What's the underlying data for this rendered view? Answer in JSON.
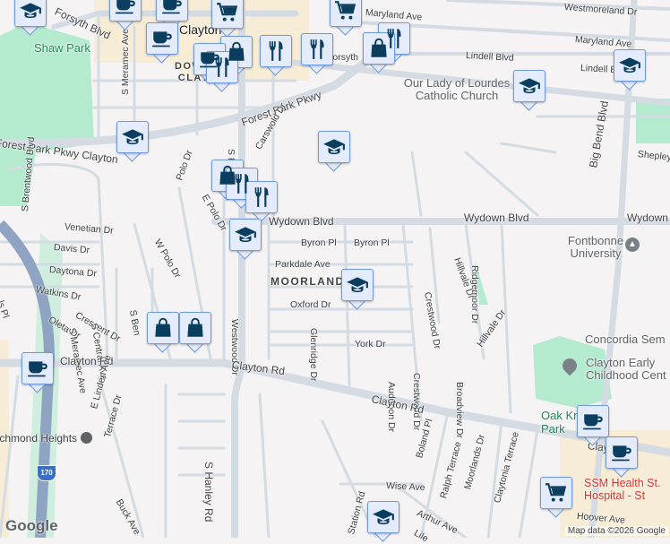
{
  "colors": {
    "background": "#f5f3f3",
    "road": "#d4dbe3",
    "park": "#b4ebcf",
    "downtown": "#f7ecd6",
    "highway": "#8fa4c2",
    "marker_fill": "#e4ecfb",
    "marker_border": "#6f9ae0",
    "icon": "#0b3d5e"
  },
  "streets": {
    "forsyth_top": "Forsyth Blvd",
    "forsyth": "Forsyth",
    "maryland": "Maryland Ave",
    "maryland_east": "Maryland Ave",
    "westmoreland": "Westmoreland Dr",
    "lindell": "Lindell Blvd",
    "lindell_east": "Lindell Blvd",
    "forest_park": "Forest Park Pkwy",
    "forest_park_clayton": "Forest Park Pkwy Clayton",
    "s_meramec": "S Meramec Ave",
    "carswold": "Carswold Dr",
    "polo": "Polo Dr",
    "e_polo": "E Polo Dr",
    "w_polo": "W Polo Dr",
    "wydown": "Wydown Blvd",
    "wydown_mid": "Wydown Blvd",
    "wydown_east": "Wydown Blvd",
    "byron1": "Byron Pl",
    "byron2": "Byron Pl",
    "parkdale": "Parkdale Ave",
    "oxford": "Oxford Dr",
    "york": "York Dr",
    "glenridge": "Glenridge Dr",
    "westwood": "Westwood Dr",
    "audubon": "Audubon Dr",
    "crestwood1": "Crestwood Dr",
    "crestwood2": "Crestwood Dr",
    "hillvale1": "Hillvale Dr",
    "hillvale2": "Hillvale Dr",
    "ridgemoor": "Ridgemoor Dr",
    "broadview": "Broadview Dr",
    "big_bend": "Big Bend Blvd",
    "shepley": "Shepley",
    "s_brentwood": "S Brentwood Blvd",
    "venetian": "Venetian Dr",
    "davis": "Davis Dr",
    "daytona": "Daytona Dr",
    "watkins": "Watkins Dr",
    "oleta": "Oleta Dr",
    "crescent": "Crescent Dr",
    "s_meramec2": "S Meramec Ave",
    "s_central": "S Central Ave",
    "s_ben": "S Ben",
    "clayton_rd_w": "Clayton Rd",
    "clayton_rd": "Clayton Rd",
    "clayton_rd_e": "Clayton Rd",
    "clay_e": "Clay",
    "e_linden": "E Linden Ave",
    "terrace": "Terrace Dr",
    "s_hanley": "S Hanley Rd",
    "buck": "Buck Ave",
    "boland": "Boland Pl",
    "ralph": "Ralph Terrace",
    "moorlands": "Moorlands Dr",
    "claytonia": "Claytonia Terrace",
    "wise": "Wise Ave",
    "arthur": "Arthur Ave",
    "station": "Station Rd",
    "hoover": "Hoover Ave",
    "lile": "Lile",
    "s_hanley_top": "S H",
    "pl": "ls Pl"
  },
  "places": {
    "clayton": "Clayton",
    "downtown_clayton": "DOWNTOWN CLAYTON",
    "shaw_park": "Shaw Park",
    "moorlands": "MOORLANDS",
    "our_lady": "Our Lady of Lourdes Catholic Church",
    "fontbonne": "Fontbonne University",
    "concordia": "Concordia Sem",
    "clayton_early": "Clayton Early Childhood Cent",
    "oak_knoll": "Oak Knoll Park",
    "ssm": "SSM Health St. Hospital - St",
    "richmond_heights": "Richmond Heights",
    "i170": "170"
  },
  "markers": [
    "graduation-cap",
    "coffee",
    "coffee",
    "shopping-cart",
    "coffee",
    "shopping-bag",
    "coffee",
    "restaurant",
    "restaurant",
    "restaurant",
    "shopping-cart",
    "shopping-bag",
    "restaurant",
    "graduation-cap",
    "graduation-cap",
    "graduation-cap",
    "graduation-cap",
    "shopping-bag",
    "restaurant",
    "restaurant",
    "graduation-cap",
    "graduation-cap",
    "shopping-bag",
    "shopping-bag",
    "coffee",
    "coffee",
    "coffee",
    "shopping-cart",
    "graduation-cap"
  ],
  "attribution": {
    "logo": "Google",
    "map_data": "Map data ©2026 Google"
  }
}
